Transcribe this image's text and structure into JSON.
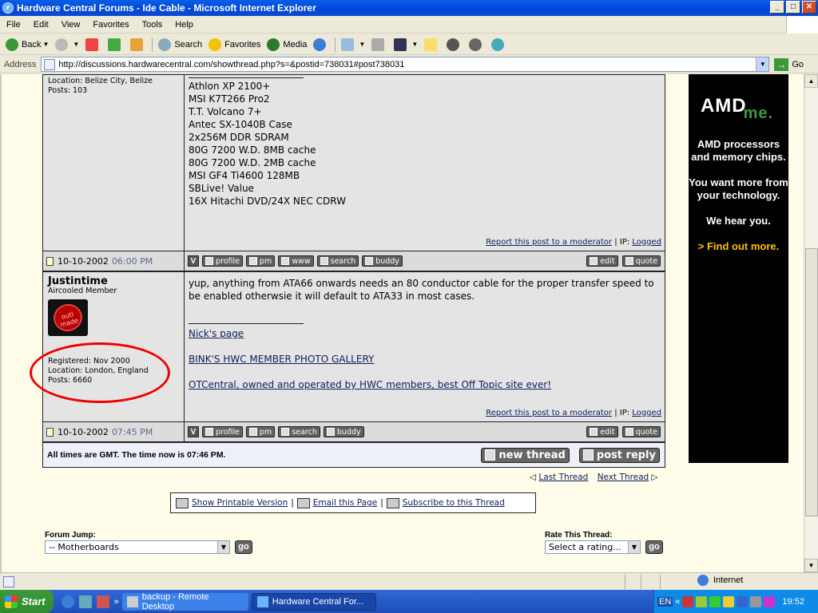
{
  "window": {
    "title": "Hardware Central Forums - Ide Cable - Microsoft Internet Explorer"
  },
  "menu": [
    "File",
    "Edit",
    "View",
    "Favorites",
    "Tools",
    "Help"
  ],
  "toolbar": {
    "back": "Back",
    "search": "Search",
    "favorites": "Favorites",
    "media": "Media"
  },
  "address": {
    "label": "Address",
    "url": "http://discussions.hardwarecentral.com/showthread.php?s=&postid=738031#post738031",
    "go": "Go"
  },
  "post1": {
    "location": "Location: Belize City, Belize",
    "posts": "Posts: 103",
    "signature": [
      "Athlon XP 2100+",
      "MSI K7T266 Pro2",
      "T.T. Volcano 7+",
      "Antec SX-1040B Case",
      "2x256M DDR SDRAM",
      "80G 7200 W.D. 8MB cache",
      "80G 7200 W.D. 2MB cache",
      "MSI GF4 Ti4600 128MB",
      "SBLive! Value",
      "16X Hitachi DVD/24X NEC CDRW"
    ],
    "report": "Report this post to a moderator",
    "ip_label": " | IP: ",
    "ip": "Logged",
    "date": "10-10-2002",
    "time": "06:00 PM"
  },
  "post2": {
    "username": "Justintime",
    "usertitle": "Aircooled Member",
    "avatar_text": "outl made",
    "registered": "Registered: Nov 2000",
    "location": "Location: London, England",
    "posts": "Posts: 6660",
    "message": "yup, anything from ATA66 onwards needs an 80 conductor cable for the proper transfer speed to be enabled otherwsie it will default to ATA33 in most cases.",
    "links": [
      "Nick's page",
      "BINK'S HWC MEMBER PHOTO GALLERY",
      "OTCentral, owned and operated by HWC members, best Off Topic site ever!"
    ],
    "report": "Report this post to a moderator",
    "ip_label": " | IP: ",
    "ip": "Logged",
    "date": "10-10-2002",
    "time": "07:45 PM"
  },
  "postbuttons": {
    "v": "V",
    "profile": "profile",
    "pm": "pm",
    "www": "www",
    "search": "search",
    "buddy": "buddy",
    "edit": "edit",
    "quote": "quote"
  },
  "footer": {
    "times": "All times are GMT. The time now is 07:46 PM.",
    "new_thread": "new thread",
    "post_reply": "post reply"
  },
  "threadnav": {
    "last": "Last Thread",
    "next": "Next Thread"
  },
  "tools": {
    "printable": "Show Printable Version",
    "email": "Email this Page",
    "subscribe": "Subscribe to this Thread"
  },
  "jump": {
    "label": "Forum Jump:",
    "selected": "-- Motherboards",
    "go": "go"
  },
  "rate": {
    "label": "Rate This Thread:",
    "selected": "Select a rating...",
    "go": "go"
  },
  "ad": {
    "brand": "AMD",
    "brand_suffix": "me.",
    "line1": "AMD processors and memory chips.",
    "line2": "You want more from your technology.",
    "line3": "We hear you.",
    "line4": "> Find out more."
  },
  "statusbar": {
    "zone": "Internet"
  },
  "taskbar": {
    "start": "Start",
    "task1": "backup - Remote Desktop",
    "task2": "Hardware Central For...",
    "lang": "EN",
    "clock": "19:52"
  }
}
